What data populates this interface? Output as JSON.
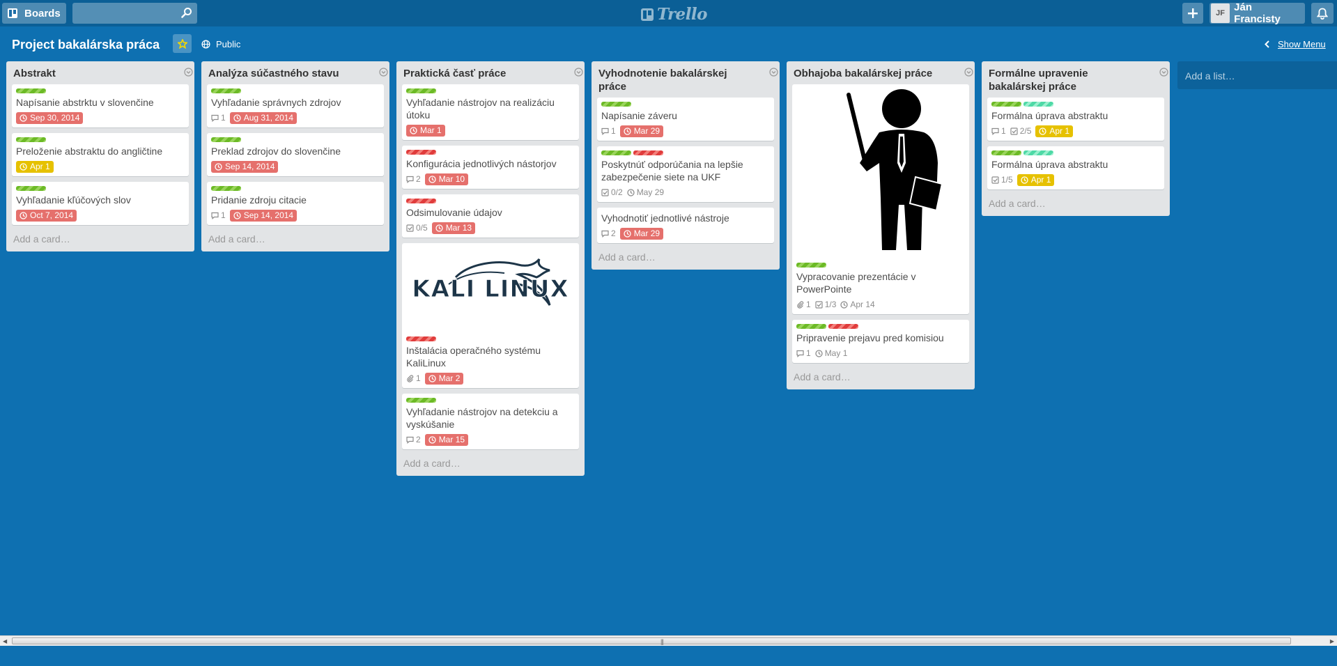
{
  "header": {
    "boards_label": "Boards",
    "search_placeholder": "",
    "logo_text": "Trello",
    "user_initials": "JF",
    "user_name": "Ján Francisty"
  },
  "board": {
    "title": "Project bakalárska práca",
    "visibility": "Public",
    "show_menu_label": "Show Menu",
    "add_list_label": "Add a list…"
  },
  "colors": {
    "background": "#0e70b1",
    "header": "#0b5f96",
    "label_green": "#6cba26",
    "label_red": "#e03c3c",
    "label_teal": "#4ed9a6",
    "due_overdue": "#e5706c",
    "due_soon": "#e6c100"
  },
  "lists": [
    {
      "title": "Abstrakt",
      "add_card": "Add a card…",
      "cards": [
        {
          "labels": [
            "green"
          ],
          "title": "Napísanie abstrktu v slovenčine",
          "comments": "",
          "attachments": "",
          "checklist": "",
          "due": "Sep 30, 2014",
          "due_status": "overdue"
        },
        {
          "labels": [
            "green"
          ],
          "title": "Preloženie abstraktu do angličtine",
          "comments": "",
          "attachments": "",
          "checklist": "",
          "due": "Apr 1",
          "due_status": "soon"
        },
        {
          "labels": [
            "green"
          ],
          "title": "Vyhľadanie kľúčových slov",
          "comments": "",
          "attachments": "",
          "checklist": "",
          "due": "Oct 7, 2014",
          "due_status": "overdue"
        }
      ]
    },
    {
      "title": "Analýza súčastného stavu",
      "add_card": "Add a card…",
      "cards": [
        {
          "labels": [
            "green"
          ],
          "title": "Vyhľadanie správnych zdrojov",
          "comments": "1",
          "attachments": "",
          "checklist": "",
          "due": "Aug 31, 2014",
          "due_status": "overdue"
        },
        {
          "labels": [
            "green"
          ],
          "title": "Preklad zdrojov do slovenčine",
          "comments": "",
          "attachments": "",
          "checklist": "",
          "due": "Sep 14, 2014",
          "due_status": "overdue"
        },
        {
          "labels": [
            "green"
          ],
          "title": "Pridanie zdroju citacie",
          "comments": "1",
          "attachments": "",
          "checklist": "",
          "due": "Sep 14, 2014",
          "due_status": "overdue"
        }
      ]
    },
    {
      "title": "Praktická časť práce",
      "add_card": "Add a card…",
      "cards": [
        {
          "labels": [
            "green"
          ],
          "title": "Vyhľadanie nástrojov na realizáciu útoku",
          "comments": "",
          "attachments": "",
          "checklist": "",
          "due": "Mar 1",
          "due_status": "overdue"
        },
        {
          "labels": [
            "red"
          ],
          "title": "Konfigurácia jednotlivých nástorjov",
          "comments": "2",
          "attachments": "",
          "checklist": "",
          "due": "Mar 10",
          "due_status": "overdue"
        },
        {
          "labels": [
            "red"
          ],
          "title": "Odsimulovanie údajov",
          "comments": "",
          "attachments": "",
          "checklist": "0/5",
          "due": "Mar 13",
          "due_status": "overdue"
        },
        {
          "cover": "kali",
          "cover_text": "KALI LINUX",
          "labels": [
            "red"
          ],
          "title": "Inštalácia operačného systému KaliLinux",
          "comments": "",
          "attachments": "1",
          "checklist": "",
          "due": "Mar 2",
          "due_status": "overdue"
        },
        {
          "labels": [
            "green"
          ],
          "title": "Vyhľadanie nástrojov na detekciu a vyskúšanie",
          "comments": "2",
          "attachments": "",
          "checklist": "",
          "due": "Mar 15",
          "due_status": "overdue"
        }
      ]
    },
    {
      "title": "Vyhodnotenie bakalárskej práce",
      "add_card": "Add a card…",
      "cards": [
        {
          "labels": [
            "green"
          ],
          "title": "Napísanie záveru",
          "comments": "1",
          "attachments": "",
          "checklist": "",
          "due": "Mar 29",
          "due_status": "overdue"
        },
        {
          "labels": [
            "green",
            "red"
          ],
          "title": "Poskytnúť odporúčania na lepšie zabezpečenie siete na UKF",
          "comments": "",
          "attachments": "",
          "checklist": "0/2",
          "due": "May 29",
          "due_status": "future"
        },
        {
          "labels": [],
          "title": "Vyhodnotiť jednotlivé nástroje",
          "comments": "2",
          "attachments": "",
          "checklist": "",
          "due": "Mar 29",
          "due_status": "overdue"
        }
      ]
    },
    {
      "title": "Obhajoba bakalárskej práce",
      "add_card": "Add a card…",
      "cards": [
        {
          "cover": "presenter",
          "labels": [
            "green"
          ],
          "title": "Vypracovanie prezentácie v PowerPointe",
          "comments": "",
          "attachments": "1",
          "checklist": "1/3",
          "due": "Apr 14",
          "due_status": "future"
        },
        {
          "labels": [
            "green",
            "red"
          ],
          "title": "Pripravenie prejavu pred komisiou",
          "comments": "1",
          "attachments": "",
          "checklist": "",
          "due": "May 1",
          "due_status": "future"
        }
      ]
    },
    {
      "title": "Formálne upravenie bakalárskej práce",
      "add_card": "Add a card…",
      "cards": [
        {
          "labels": [
            "green",
            "teal"
          ],
          "title": "Formálna úprava abstraktu",
          "comments": "1",
          "attachments": "",
          "checklist": "2/5",
          "due": "Apr 1",
          "due_status": "soon"
        },
        {
          "labels": [
            "green",
            "teal"
          ],
          "title": "Formálna úprava abstraktu",
          "comments": "",
          "attachments": "",
          "checklist": "1/5",
          "due": "Apr 1",
          "due_status": "soon"
        }
      ]
    }
  ]
}
